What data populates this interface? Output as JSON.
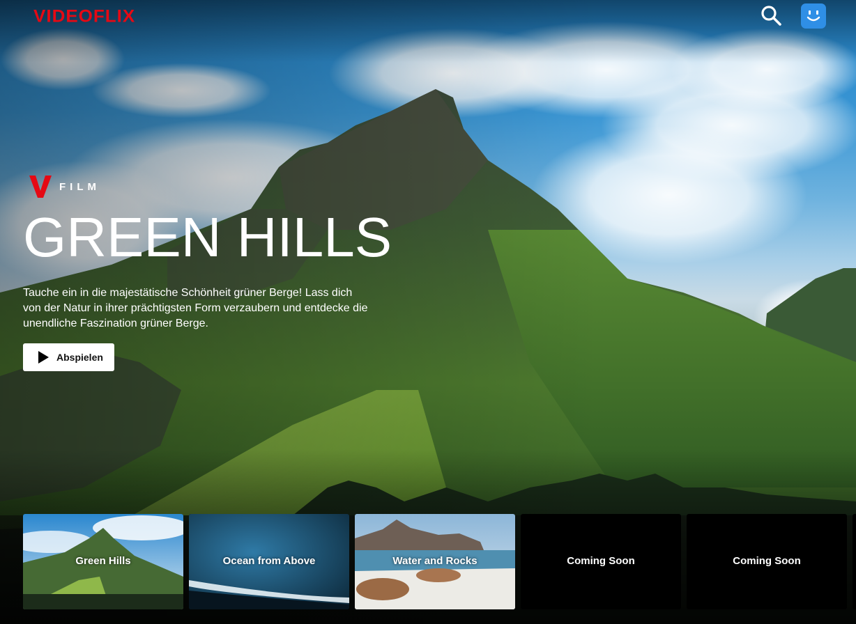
{
  "app": {
    "brand": "VIDEOFLIX"
  },
  "topbar": {
    "search_icon": "search-icon",
    "avatar_icon": "smiley-avatar-icon"
  },
  "hero": {
    "badge_logo": "V",
    "badge_label": "FILM",
    "title": "GREEN HILLS",
    "description": "Tauche ein in die majestätische Schönheit grüner Berge! Lass dich von der Natur in ihrer prächtigsten Form verzaubern und entdecke die unendliche Faszination grüner Berge.",
    "play_label": "Abspielen",
    "play_icon": "play-icon"
  },
  "row": {
    "items": [
      {
        "label": "Green Hills",
        "art": "mountain"
      },
      {
        "label": "Ocean from Above",
        "art": "ocean"
      },
      {
        "label": "Water and Rocks",
        "art": "beach"
      },
      {
        "label": "Coming Soon",
        "art": "blank"
      },
      {
        "label": "Coming Soon",
        "art": "blank"
      }
    ]
  },
  "colors": {
    "brand": "#e50914",
    "avatar": "#2f8fe6",
    "button_bg": "#ffffff",
    "text": "#ffffff"
  }
}
